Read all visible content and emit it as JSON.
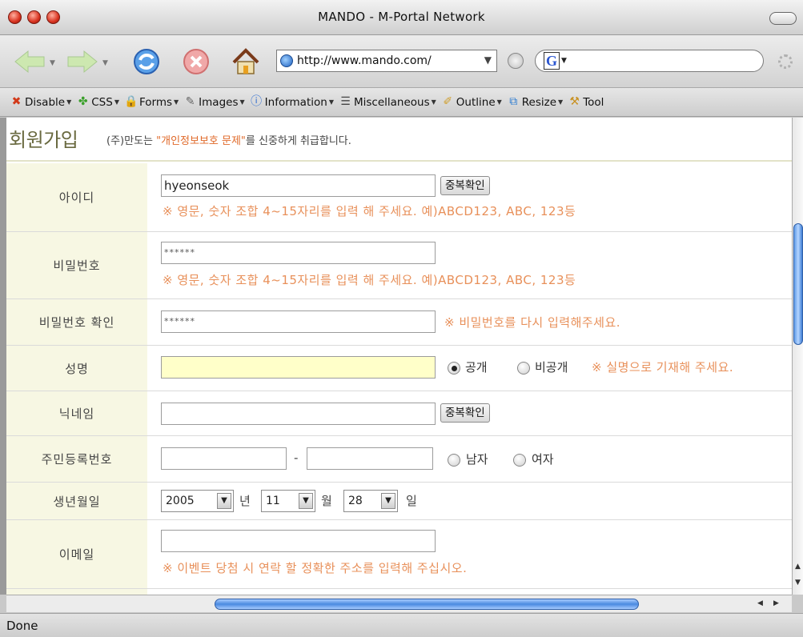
{
  "window": {
    "title": "MANDO - M-Portal Network"
  },
  "nav": {
    "url": "http://www.mando.com/",
    "search_logo": "G"
  },
  "devtoolbar": {
    "items": [
      {
        "label": "Disable",
        "icon": "x-icon",
        "color": "#d23a1a"
      },
      {
        "label": "CSS",
        "icon": "puzzle-icon",
        "color": "#3aa02a"
      },
      {
        "label": "Forms",
        "icon": "lock-icon",
        "color": "#d8a020"
      },
      {
        "label": "Images",
        "icon": "image-icon",
        "color": "#666666"
      },
      {
        "label": "Information",
        "icon": "info-icon",
        "color": "#2a6ad0"
      },
      {
        "label": "Miscellaneous",
        "icon": "list-icon",
        "color": "#444444"
      },
      {
        "label": "Outline",
        "icon": "pencil-icon",
        "color": "#d0a030"
      },
      {
        "label": "Resize",
        "icon": "resize-icon",
        "color": "#2a7ad0"
      },
      {
        "label": "Tool",
        "icon": "toolbox-icon",
        "color": "#c89020"
      }
    ]
  },
  "page": {
    "title": "회원가입",
    "subtitle_pre": "(주)만도는 ",
    "subtitle_hl": "\"개인정보보호 문제\"",
    "subtitle_post": "를 신중하게 취급합니다."
  },
  "form": {
    "id": {
      "label": "아이디",
      "value": "hyeonseok",
      "button": "중복확인",
      "hint": "※ 영문, 숫자 조합 4~15자리를 입력 해 주세요. 예)ABCD123, ABC, 123등"
    },
    "password": {
      "label": "비밀번호",
      "value": "******",
      "hint": "※ 영문, 숫자 조합 4~15자리를 입력 해 주세요. 예)ABCD123, ABC, 123등"
    },
    "password_confirm": {
      "label": "비밀번호 확인",
      "value": "******",
      "hint": "※ 비밀번호를 다시 입력해주세요."
    },
    "name": {
      "label": "성명",
      "value": "",
      "radio_public": "공개",
      "radio_private": "비공개",
      "hint": "※ 실명으로 기재해 주세요."
    },
    "nickname": {
      "label": "닉네임",
      "value": "",
      "button": "중복확인"
    },
    "resident": {
      "label": "주민등록번호",
      "part1": "",
      "dash": "-",
      "part2": "",
      "male": "남자",
      "female": "여자"
    },
    "birth": {
      "label": "생년월일",
      "year": "2005",
      "year_unit": "년",
      "month": "11",
      "month_unit": "월",
      "day": "28",
      "day_unit": "일"
    },
    "email": {
      "label": "이메일",
      "value": "",
      "hint": "※ 이벤트 당첨 시 연락 할 정확한 주소를 입력해 주십시오."
    }
  },
  "status": {
    "text": "Done"
  },
  "colors": {
    "hint": "#e8905a",
    "label_bg": "#f7f7e3",
    "title": "#6a6a40",
    "accent": "#e06a2a"
  }
}
